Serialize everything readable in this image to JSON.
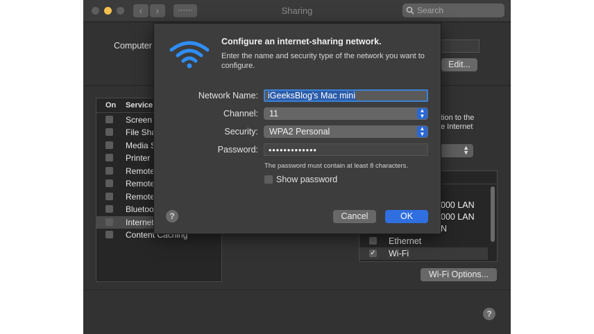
{
  "window": {
    "title": "Sharing",
    "search": {
      "placeholder": "Search"
    },
    "computer_name_label": "Computer",
    "edit_button": "Edit...",
    "services": {
      "col_on": "On",
      "col_service": "Service",
      "items": [
        {
          "label": "Screen",
          "checked": false
        },
        {
          "label": "File Sha",
          "checked": false
        },
        {
          "label": "Media S",
          "checked": false
        },
        {
          "label": "Printer",
          "checked": false
        },
        {
          "label": "Remote",
          "checked": false
        },
        {
          "label": "Remote",
          "checked": false
        },
        {
          "label": "Remote",
          "checked": false
        },
        {
          "label": "Bluetoo",
          "checked": false
        },
        {
          "label": "Internet",
          "checked": false,
          "selected": true
        },
        {
          "label": "Content Caching",
          "checked": false
        }
      ]
    },
    "right_text": [
      "tion to the",
      "e Internet"
    ],
    "right_list": {
      "partial_items": [
        "000 LAN",
        "000 LAN",
        "N"
      ],
      "items": [
        {
          "label": "Ethernet",
          "checked": false
        },
        {
          "label": "Wi-Fi",
          "checked": true
        }
      ]
    },
    "wifi_options_button": "Wi-Fi Options...",
    "help": "?"
  },
  "sheet": {
    "heading": "Configure an internet-sharing network.",
    "description": "Enter the name and security type of the network you want to configure.",
    "network_name": {
      "label": "Network Name:",
      "value": "iGeeksBlog's Mac mini"
    },
    "channel": {
      "label": "Channel:",
      "value": "11"
    },
    "security": {
      "label": "Security:",
      "value": "WPA2 Personal"
    },
    "password": {
      "label": "Password:",
      "value": "•••••••••••••",
      "hint": "The password must contain at least 8 characters."
    },
    "show_password": {
      "label": "Show password",
      "checked": false
    },
    "cancel": "Cancel",
    "ok": "OK",
    "help": "?"
  },
  "colors": {
    "accent": "#2a67d3",
    "ok_button": "#2f6fe0",
    "traffic_yellow": "#f5bf4f"
  }
}
